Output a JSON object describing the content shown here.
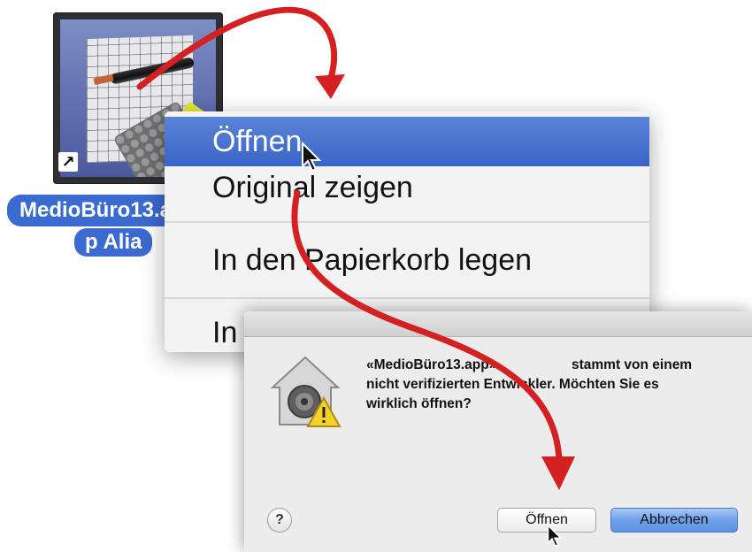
{
  "desktop_icon": {
    "label_line1": "MedioBüro13.a",
    "label_line2": "p Alia"
  },
  "context_menu": {
    "items": [
      {
        "label": "Öffnen",
        "selected": true
      },
      {
        "label": "Original zeigen"
      },
      {
        "label": "In den Papierkorb legen"
      },
      {
        "label": "In"
      }
    ]
  },
  "dialog": {
    "app_name": "«MedioBüro13.app»",
    "message_part1": "stammt von einem",
    "message_part2": "nicht verifizierten Entwickler. Möchten Sie es",
    "message_part3": "wirklich öffnen?",
    "help_label": "?",
    "open_button": "Öffnen",
    "cancel_button": "Abbrechen"
  },
  "colors": {
    "annotation_arrow": "#d42020",
    "selection": "#3a64c6",
    "default_button": "#6ea0ea"
  },
  "icons": [
    "alias-arrow-icon",
    "gatekeeper-house-icon",
    "warning-icon",
    "cursor-icon"
  ]
}
